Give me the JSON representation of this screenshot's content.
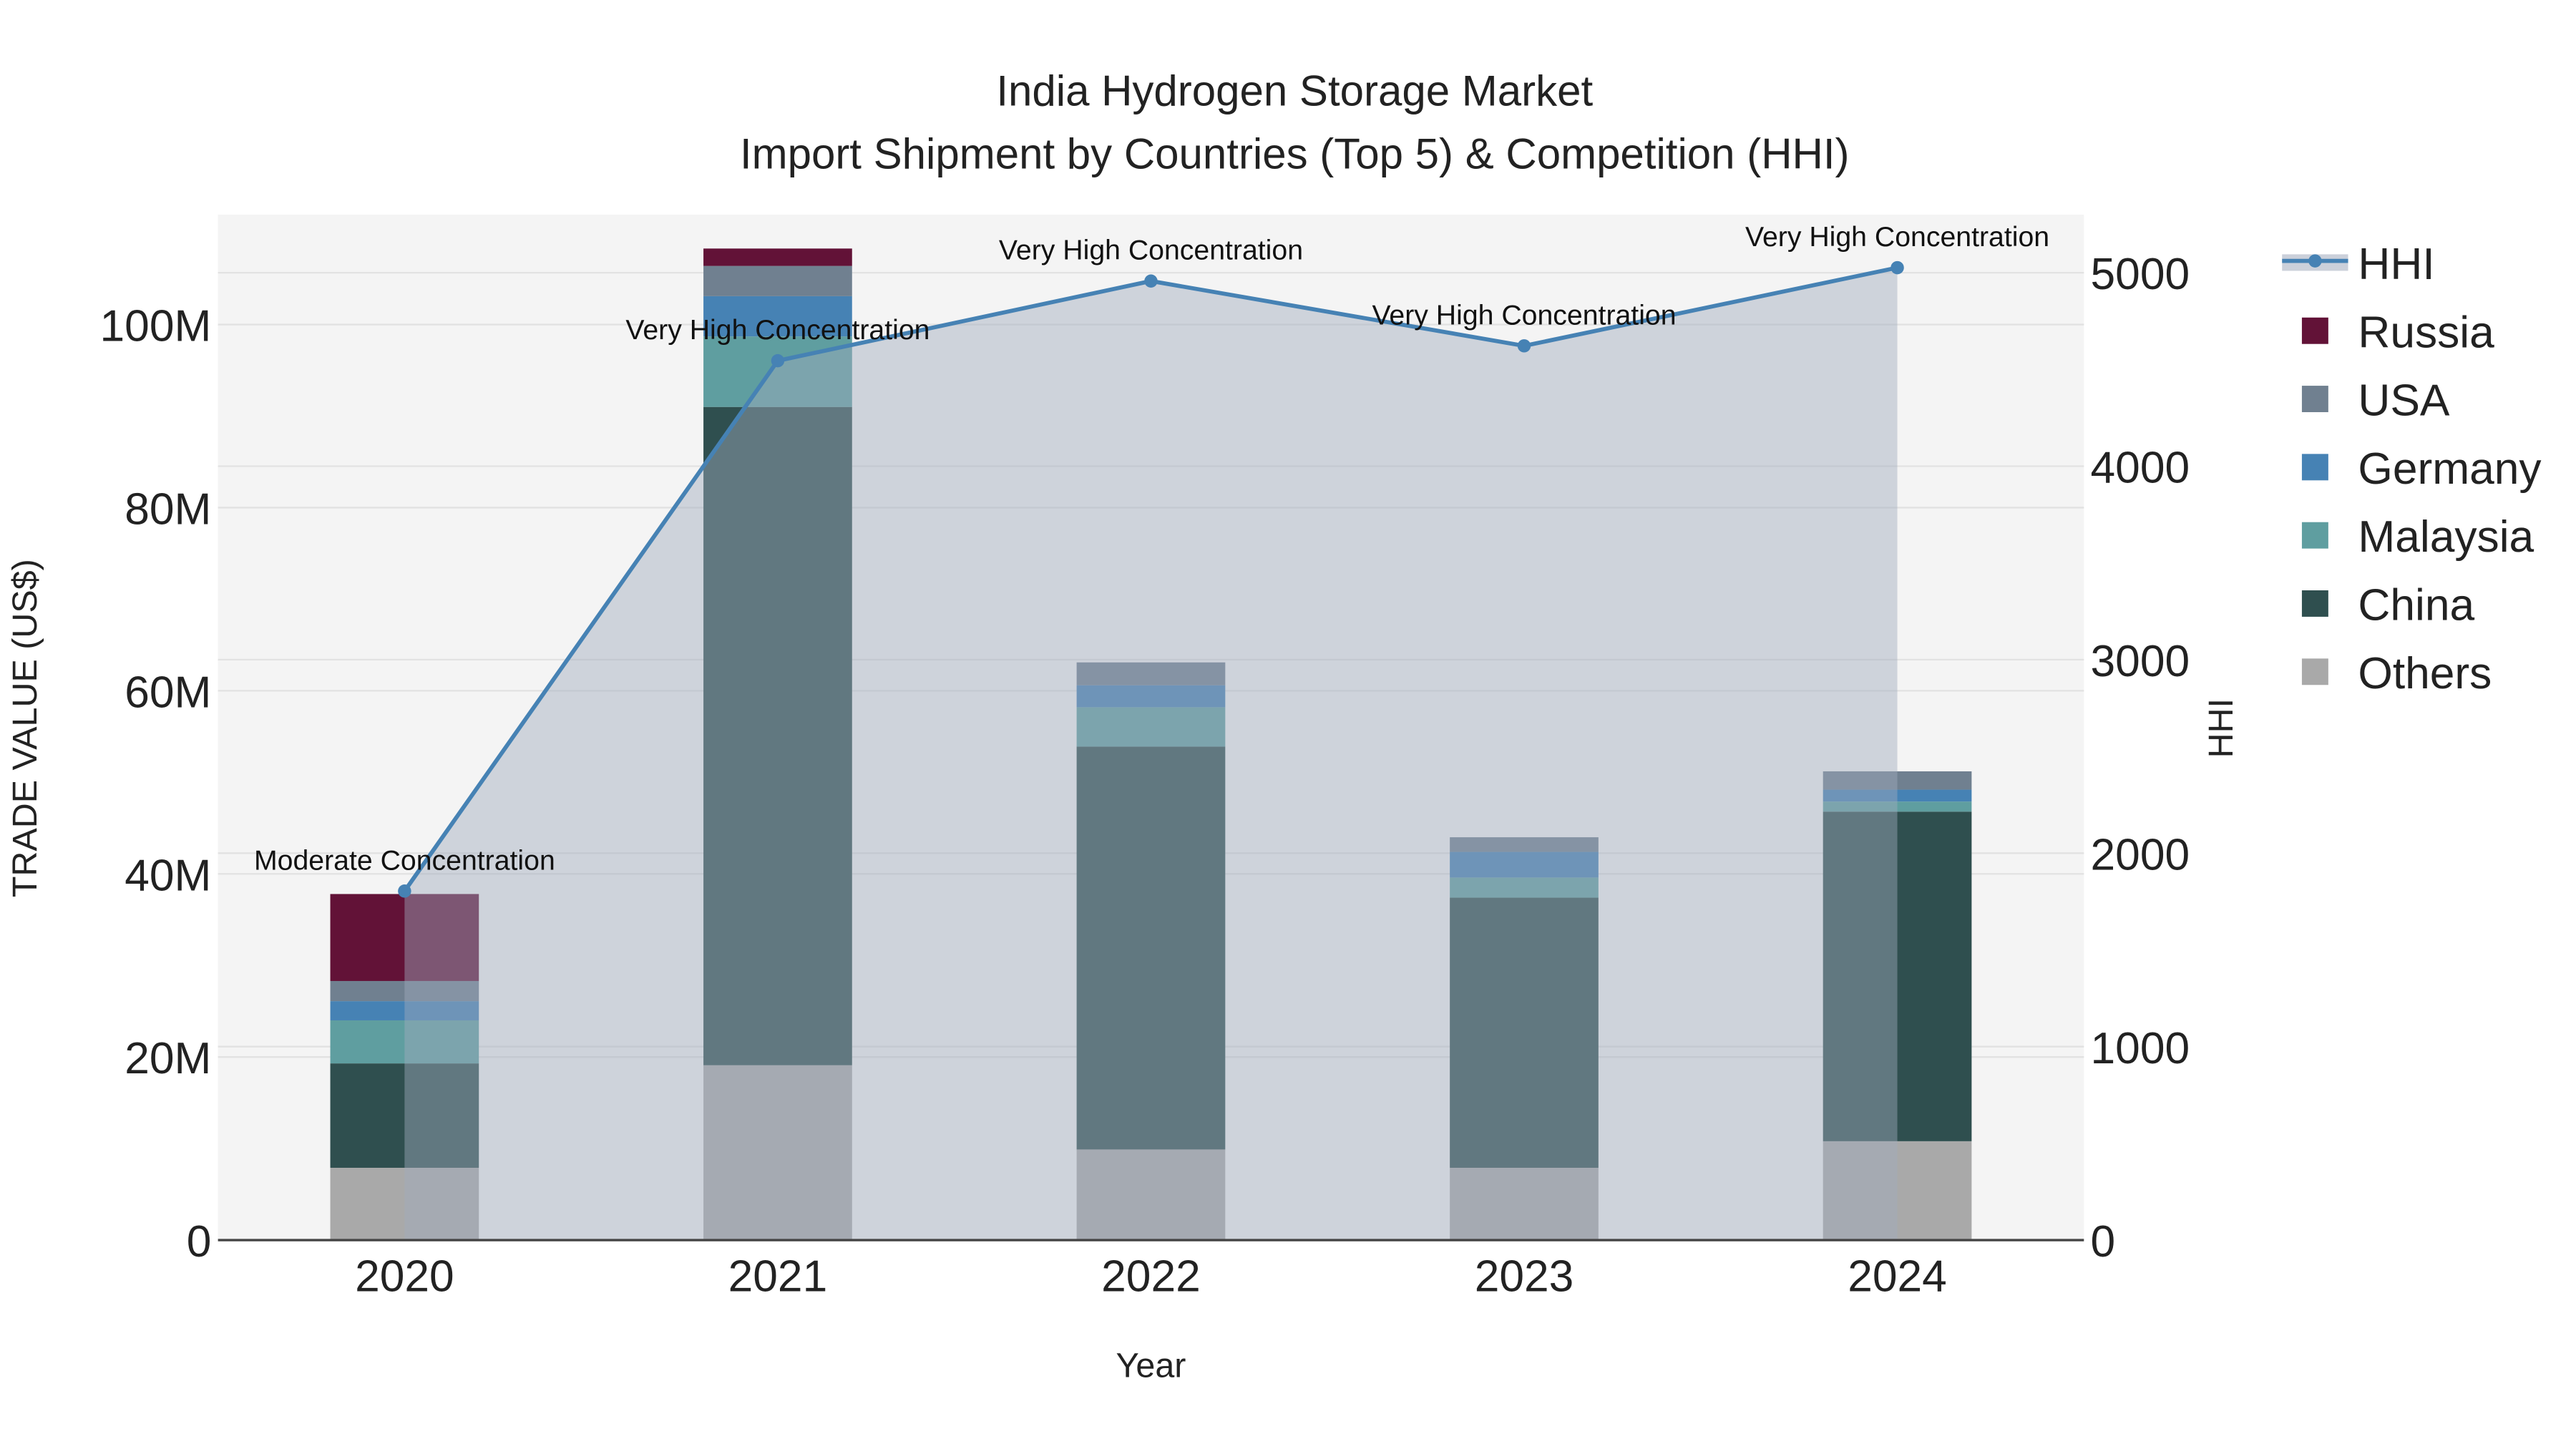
{
  "chart_data": {
    "type": "bar",
    "title": "India Hydrogen Storage Market",
    "subtitle": "Import Shipment by Countries (Top 5) & Competition (HHI)",
    "xlabel": "Year",
    "ylabel": "TRADE VALUE (US$)",
    "y2label": "HHI",
    "categories": [
      "2020",
      "2021",
      "2022",
      "2023",
      "2024"
    ],
    "ylim": [
      0,
      112
    ],
    "y_ticks": [
      0,
      20,
      40,
      60,
      80,
      100
    ],
    "y_tick_labels": [
      "0",
      "20M",
      "40M",
      "60M",
      "80M",
      "100M"
    ],
    "y2lim": [
      0,
      5300
    ],
    "y2_ticks": [
      0,
      1000,
      2000,
      3000,
      4000,
      5000
    ],
    "y2_tick_labels": [
      "0",
      "1000",
      "2000",
      "3000",
      "4000",
      "5000"
    ],
    "units": "US$ millions",
    "series": [
      {
        "name": "Others",
        "color": "#a9a9a9",
        "values": [
          7.9,
          19.1,
          9.9,
          7.9,
          10.8
        ]
      },
      {
        "name": "China",
        "color": "#2f4f4f",
        "values": [
          11.4,
          71.9,
          44.0,
          29.5,
          36.0
        ]
      },
      {
        "name": "Malaysia",
        "color": "#5f9ea0",
        "values": [
          4.7,
          7.7,
          4.3,
          2.2,
          1.1
        ]
      },
      {
        "name": "Germany",
        "color": "#4682b4",
        "values": [
          2.1,
          4.4,
          2.4,
          2.8,
          1.3
        ]
      },
      {
        "name": "USA",
        "color": "#708090",
        "values": [
          2.2,
          3.3,
          2.5,
          1.6,
          2.0
        ]
      },
      {
        "name": "Russia",
        "color": "#621237",
        "values": [
          9.5,
          1.9,
          0,
          0,
          0
        ]
      }
    ],
    "hhi": {
      "name": "HHI",
      "color": "#4682b4",
      "values": [
        1804,
        4545,
        4957,
        4622,
        5026
      ],
      "annotations": [
        "Moderate Concentration",
        "Very High Concentration",
        "Very High Concentration",
        "Very High Concentration",
        "Very High Concentration"
      ]
    },
    "legend_order": [
      "HHI",
      "Russia",
      "USA",
      "Germany",
      "Malaysia",
      "China",
      "Others"
    ],
    "legend_position": "right",
    "grid": true
  }
}
